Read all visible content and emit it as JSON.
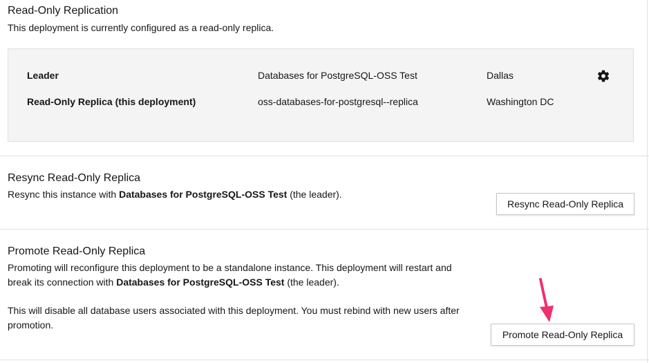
{
  "replication": {
    "title": "Read-Only Replication",
    "description": "This deployment is currently configured as a read-only replica.",
    "rows": [
      {
        "role": "Leader",
        "name": "Databases for PostgreSQL-OSS Test",
        "location": "Dallas"
      },
      {
        "role": "Read-Only Replica (this deployment)",
        "name": "oss-databases-for-postgresql--replica",
        "location": "Washington DC"
      }
    ],
    "settings_icon": "gear-icon"
  },
  "resync": {
    "title": "Resync Read-Only Replica",
    "desc_pre": "Resync this instance with ",
    "desc_bold": "Databases for PostgreSQL-OSS Test",
    "desc_post": " (the leader).",
    "button_label": "Resync Read-Only Replica"
  },
  "promote": {
    "title": "Promote Read-Only Replica",
    "desc1_line1": "Promoting will reconfigure this deployment to be a standalone instance. This deployment will restart and",
    "desc1_line2_pre": "break its connection with ",
    "desc1_bold": "Databases for PostgreSQL-OSS Test",
    "desc1_line2_post": " (the leader).",
    "desc2_line1": "This will disable all database users associated with this deployment. You must rebind with new users after",
    "desc2_line2": "promotion.",
    "button_label": "Promote Read-Only Replica"
  },
  "annotation": {
    "arrow_color": "#f0306c",
    "arrow_icon": "pointer-arrow-icon"
  }
}
